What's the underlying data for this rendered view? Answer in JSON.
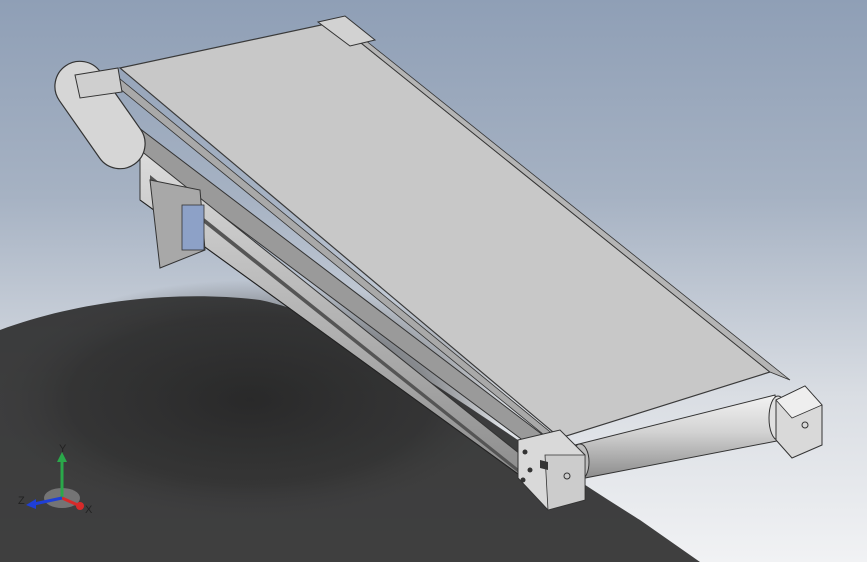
{
  "viewport": {
    "background_top": "#8f9fb6",
    "background_bottom": "#f1f2f4",
    "model_name": "belt-conveyor"
  },
  "triad": {
    "x_label": "X",
    "y_label": "Y",
    "z_label": "Z",
    "x_color": "#d62a2a",
    "y_color": "#2aa84a",
    "z_color": "#1f3fd6"
  }
}
